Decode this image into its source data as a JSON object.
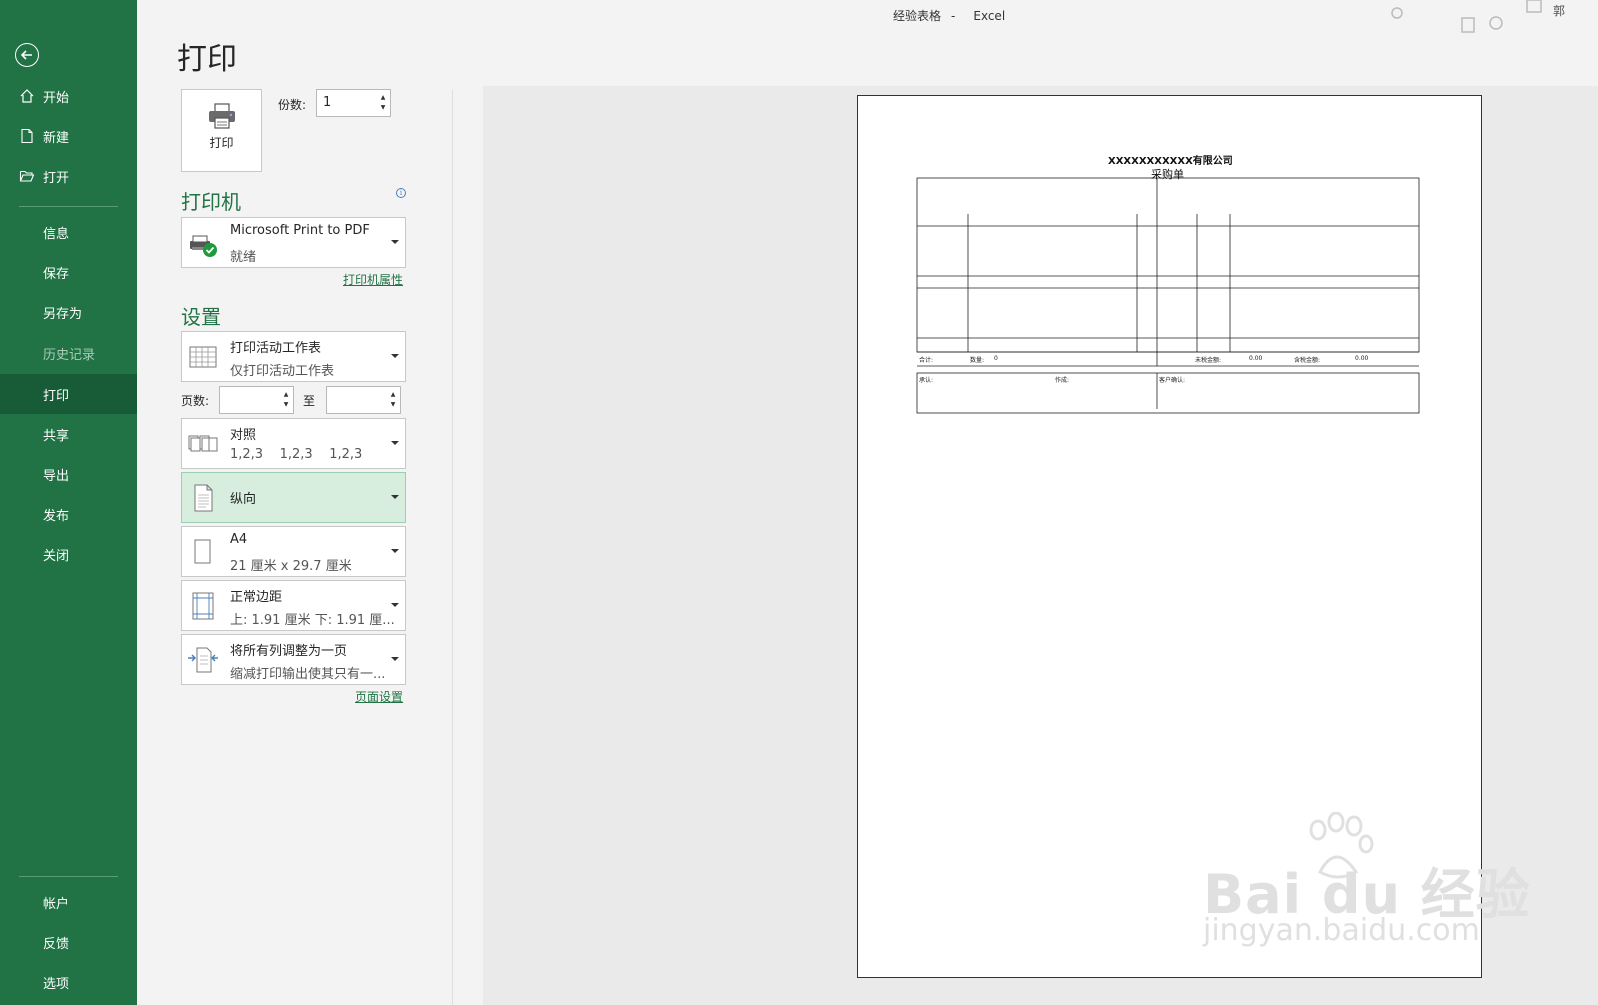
{
  "window": {
    "title": "经验表格",
    "separator": "-",
    "app": "Excel",
    "corner_char": "郭"
  },
  "sidebar": {
    "back_icon": "arrow-left-circle-icon",
    "top_items": [
      {
        "label": "开始",
        "icon": "home-icon"
      },
      {
        "label": "新建",
        "icon": "new-document-icon"
      },
      {
        "label": "打开",
        "icon": "open-folder-icon"
      }
    ],
    "middle_items": [
      {
        "label": "信息"
      },
      {
        "label": "保存"
      },
      {
        "label": "另存为"
      },
      {
        "label": "历史记录",
        "state": "disabled"
      },
      {
        "label": "打印",
        "state": "selected"
      },
      {
        "label": "共享"
      },
      {
        "label": "导出"
      },
      {
        "label": "发布"
      },
      {
        "label": "关闭"
      }
    ],
    "bottom_items": [
      {
        "label": "帐户"
      },
      {
        "label": "反馈"
      },
      {
        "label": "选项"
      }
    ]
  },
  "print": {
    "page_title": "打印",
    "print_button_label": "打印",
    "copies_label": "份数:",
    "copies_value": "1"
  },
  "printer": {
    "heading": "打印机",
    "name": "Microsoft Print to PDF",
    "status": "就绪",
    "properties_link": "打印机属性"
  },
  "settings": {
    "heading": "设置",
    "scope": {
      "main": "打印活动工作表",
      "sub": "仅打印活动工作表"
    },
    "pages_label": "页数:",
    "pages_from": "",
    "to_label": "至",
    "pages_to": "",
    "collation": {
      "main": "对照",
      "sub": "1,2,3    1,2,3    1,2,3"
    },
    "orientation": {
      "main": "纵向"
    },
    "paper": {
      "main": "A4",
      "sub": "21 厘米 x 29.7 厘米"
    },
    "margins": {
      "main": "正常边距",
      "sub": "上: 1.91 厘米 下: 1.91 厘..."
    },
    "scaling": {
      "main": "将所有列调整为一页",
      "sub": "缩减打印输出使其只有一..."
    },
    "page_setup_link": "页面设置"
  },
  "preview": {
    "company": "XXXXXXXXXXX有限公司",
    "doc_title": "采购单",
    "total_label": "合计:",
    "qty_label": "数量:",
    "qty_value": "0",
    "untaxed_label": "未税金额:",
    "untaxed_value": "0.00",
    "taxed_label": "含税金额:",
    "taxed_value": "0.00",
    "approve_label": "承认:",
    "make_label": "作成:",
    "customer_label": "客户确认:"
  },
  "watermark": {
    "main": "Bai du 经验",
    "sub": "jingyan.baidu.com"
  },
  "colors": {
    "accent": "#217346",
    "selected": "#185c37",
    "highlight": "#d7eedf"
  }
}
